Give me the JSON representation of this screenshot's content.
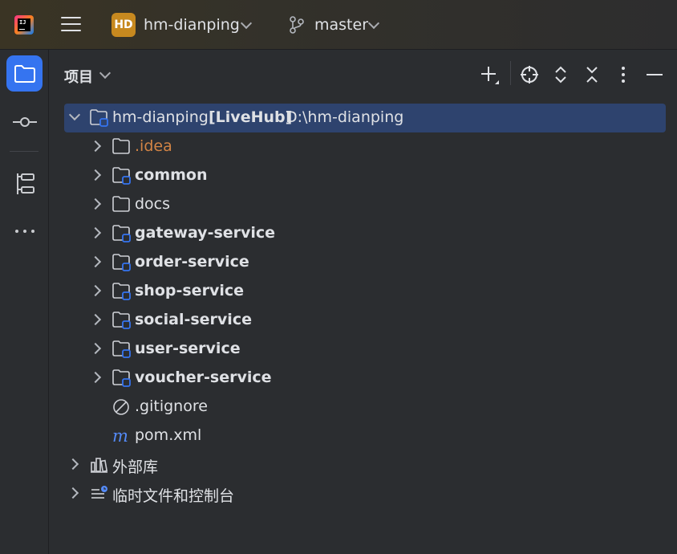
{
  "titlebar": {
    "project_badge": "HD",
    "project_name": "hm-dianping",
    "branch": "master"
  },
  "panel": {
    "title": "项目"
  },
  "tree": {
    "root": {
      "name": "hm-dianping",
      "tag": "[LiveHub]",
      "path": "D:\\hm-dianping"
    },
    "children": [
      {
        "label": ".idea"
      },
      {
        "label": "common"
      },
      {
        "label": "docs"
      },
      {
        "label": "gateway-service"
      },
      {
        "label": "order-service"
      },
      {
        "label": "shop-service"
      },
      {
        "label": "social-service"
      },
      {
        "label": "user-service"
      },
      {
        "label": "voucher-service"
      },
      {
        "label": ".gitignore"
      },
      {
        "label": "pom.xml"
      }
    ],
    "external_libraries": "外部库",
    "scratches": "临时文件和控制台"
  },
  "colors": {
    "accent": "#3574f0",
    "selection": "#2e436e",
    "badge": "#c7891f",
    "idea_folder_text": "#d28445",
    "module_marker": "#3574f0"
  },
  "icons": [
    "app-logo-icon",
    "hamburger-menu-icon",
    "chevron-down-icon",
    "branch-icon",
    "folder-icon",
    "commit-icon",
    "structure-icon",
    "more-horizontal-icon",
    "add-icon",
    "locate-icon",
    "expand-all-icon",
    "collapse-all-icon",
    "more-vertical-icon",
    "minimize-icon",
    "module-folder-icon",
    "ignore-file-icon",
    "maven-icon",
    "library-icon",
    "scratches-icon"
  ]
}
